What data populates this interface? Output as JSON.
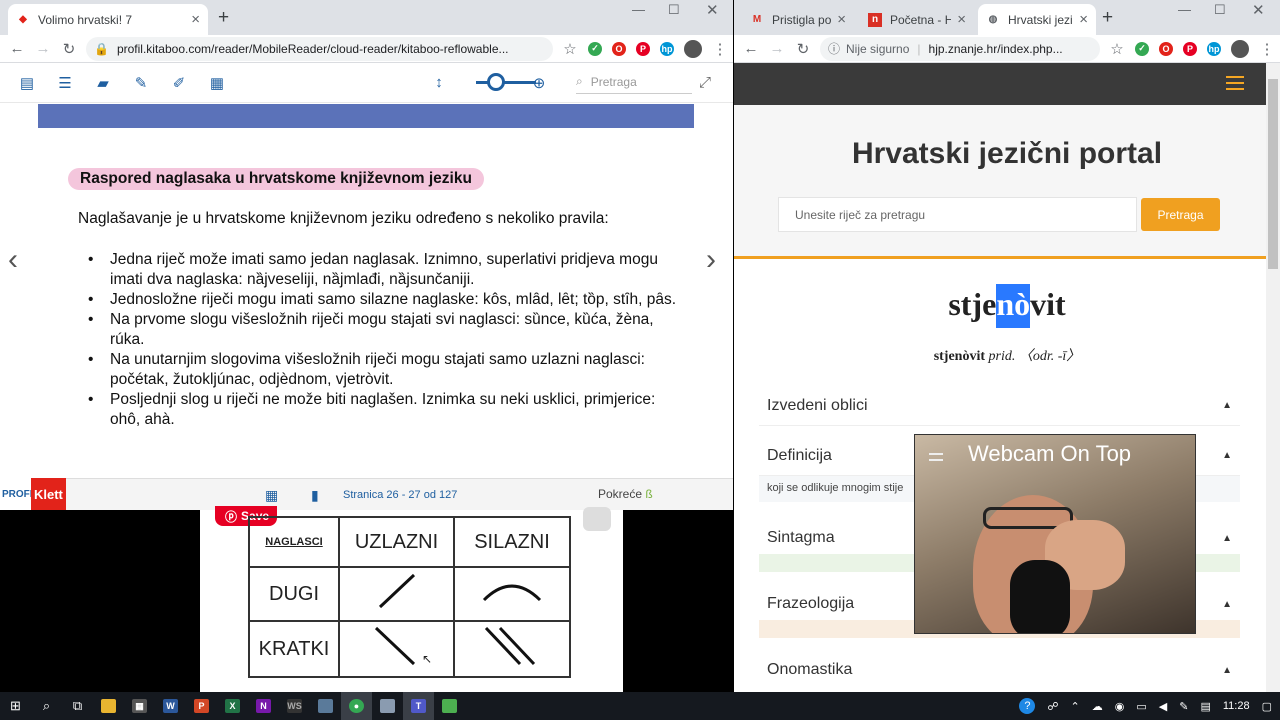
{
  "left_window": {
    "tab_title": "Volimo hrvatski! 7",
    "url": "profil.kitaboo.com/reader/MobileReader/cloud-reader/kitaboo-reflowable...",
    "reader": {
      "search_placeholder": "Pretraga",
      "heading": "Raspored naglasaka u hrvatskome književnom jeziku",
      "intro": "Naglašavanje je u hrvatskome književnom jeziku određeno s nekoliko pravila:",
      "rules": [
        "Jedna riječ može imati samo jedan naglasak. Iznimno, superlativi pridjeva mogu imati dva naglaska: nȁjveseliji, nȁjmlađi, nȁjsunčaniji.",
        "Jednosložne riječi mogu imati samo silazne naglaske: kôs, mlȃd, lȇt; tȍp, stȋh, pȃs.",
        "Na prvome slogu višesložnih riječi mogu stajati svi naglasci: sȕnce, kȕća, žèna, rúka.",
        "Na unutarnjim slogovima višesložnih riječi mogu stajati samo uzlazni naglasci: počétak, žutokljúnac, odjèdnom, vjetròvit.",
        "Posljednji slog u riječi ne može biti naglašen. Iznimka su neki usklici, primjerice: ohô, ahà."
      ],
      "page_info": "Stranica 26 - 27 od 127",
      "publisher_a": "PROFIL",
      "publisher_b": "Klett",
      "launch_label": "Pokreće"
    }
  },
  "video": {
    "save_label": "Save",
    "table": {
      "header": [
        "NAGLASCI",
        "UZLAZNI",
        "SILAZNI"
      ],
      "rows": [
        "DUGI",
        "KRATKI"
      ]
    }
  },
  "right_window": {
    "tabs": [
      "Pristigla pošta",
      "Početna - Hrv",
      "Hrvatski jezič"
    ],
    "security": "Nije sigurno",
    "url": "hjp.znanje.hr/index.php...",
    "portal_title": "Hrvatski jezični portal",
    "search_placeholder": "Unesite riječ za pretragu",
    "search_button": "Pretraga",
    "word_pre": "stje",
    "word_hl": "nò",
    "word_post": "vit",
    "grammar_word": "stjenòvit",
    "grammar_rest": "prid. 〈odr. -ī〉",
    "sections": [
      "Izvedeni oblici",
      "Definicija",
      "Sintagma",
      "Frazeologija",
      "Onomastika"
    ],
    "definition_snippet": "koji se odlikuje mnogim stije"
  },
  "webcam": {
    "title": "Webcam On Top"
  },
  "taskbar": {
    "time": "11:28"
  },
  "colors": {
    "accent_blue": "#1f5fa0",
    "portal_orange": "#f0a020",
    "highlight_blue": "#2979ff",
    "heading_pink": "#f4c6dc"
  }
}
